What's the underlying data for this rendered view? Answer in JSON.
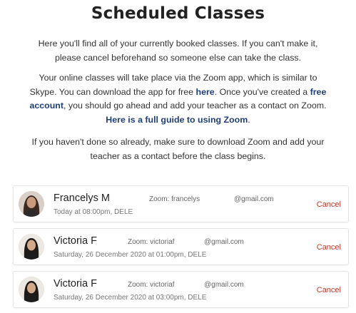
{
  "page": {
    "title": "Scheduled Classes",
    "intro": "Here you'll find all of your currently booked classes. If you can't make it, please cancel beforehand so someone else can take the class.",
    "zoom_info": {
      "text_1": "Your online classes will take place via the Zoom app, which is similar to Skype. You can download the app for free ",
      "link_here": "here",
      "text_2": ". Once you've created a ",
      "link_account": "free account",
      "text_3": ", you should go ahead and add your teacher as a contact on Zoom. ",
      "link_guide": "Here is a full guide to using Zoom",
      "text_4": "."
    },
    "reminder": "If you haven't done so already, make sure to download Zoom and add your teacher as a contact before the class begins."
  },
  "classes": [
    {
      "teacher": "Francelys M",
      "when": "Today at 08:00pm, DELE",
      "zoom": "Zoom: francelys",
      "email": "@gmail.com",
      "cancel": "Cancel"
    },
    {
      "teacher": "Victoria F",
      "when": "Saturday, 26 December 2020 at 01:00pm, DELE",
      "zoom": "Zoom: victoriaf",
      "email": "@gmail.com",
      "cancel": "Cancel"
    },
    {
      "teacher": "Victoria F",
      "when": "Saturday, 26 December 2020 at 03:00pm, DELE",
      "zoom": "Zoom: victoriaf",
      "email": "@gmail.com",
      "cancel": "Cancel"
    }
  ],
  "colors": {
    "link": "#1f3f7a",
    "cancel": "#c0392b",
    "text": "#333333"
  }
}
